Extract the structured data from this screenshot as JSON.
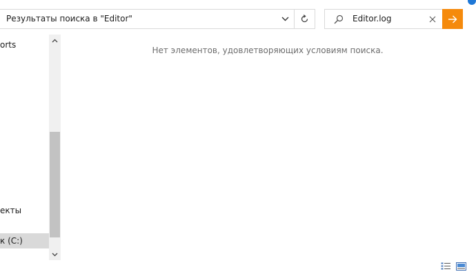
{
  "address_bar": {
    "path_text": "Результаты поиска в \"Editor\"",
    "dropdown_icon": "chevron-down-icon",
    "refresh_icon": "refresh-icon"
  },
  "search": {
    "query": "Editor.log",
    "search_icon": "search-icon",
    "clear_icon": "close-icon",
    "go_icon": "arrow-right-icon"
  },
  "nav_pane": {
    "items": [
      {
        "label": "orts"
      },
      {
        "label": "екты"
      },
      {
        "label": "к (C:)",
        "selected": true
      }
    ]
  },
  "content": {
    "empty_message": "Нет элементов, удовлетворяющих условиям поиска."
  },
  "status_bar": {
    "view_buttons": [
      "details-view-icon",
      "large-icons-view-icon"
    ]
  },
  "colors": {
    "accent_orange": "#f58a0c",
    "selection_gray": "#d9d9d9",
    "scroll_thumb": "#c2c2c2",
    "help_blue": "#1e78d7"
  }
}
